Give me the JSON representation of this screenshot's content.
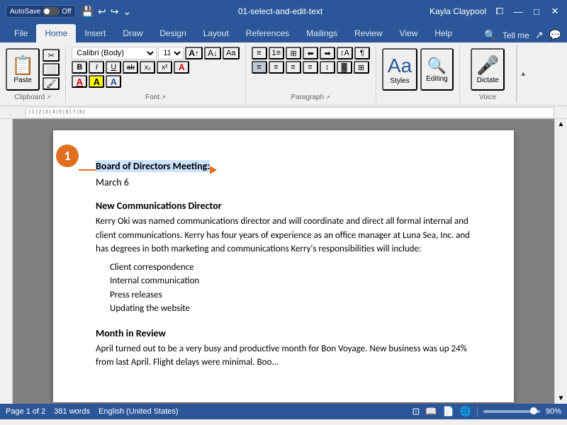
{
  "titleBar": {
    "autosave": "AutoSave",
    "autosaveState": "Off",
    "filename": "01-select-and-edit-text",
    "user": "Kayla Claypool",
    "undoIcon": "↩",
    "redoIcon": "↪",
    "moreIcon": "⌄"
  },
  "ribbonTabs": {
    "tabs": [
      "File",
      "Home",
      "Insert",
      "Draw",
      "Design",
      "Layout",
      "References",
      "Mailings",
      "Review",
      "View",
      "Help"
    ],
    "activeTab": "Home",
    "tellMe": "Tell me"
  },
  "clipboard": {
    "groupLabel": "Clipboard",
    "paste": "Paste",
    "cut": "✂",
    "copy": "⬜",
    "formatPainter": "🖌"
  },
  "font": {
    "groupLabel": "Font",
    "fontName": "Calibri (Body)",
    "fontSize": "11",
    "bold": "B",
    "italic": "I",
    "underline": "U",
    "strikethrough": "ab",
    "subscript": "x₂",
    "superscript": "x²",
    "clearFormat": "A",
    "fontColor": "A",
    "highlight": "A",
    "textEffect": "A",
    "increaseSize": "A↑",
    "decreaseSize": "A↓",
    "changeCase": "Aa"
  },
  "paragraph": {
    "groupLabel": "Paragraph",
    "bullets": "≡",
    "numbering": "1≡",
    "multilevel": "⊞≡",
    "decreaseIndent": "⬅≡",
    "increaseIndent": "➡≡",
    "sort": "↕A",
    "showHide": "¶",
    "alignLeft": "≡",
    "alignCenter": "≡",
    "alignRight": "≡",
    "justify": "≡",
    "lineSpacing": "↕",
    "shading": "▓",
    "borders": "⊞",
    "alignBottom": "⬇"
  },
  "styles": {
    "groupLabel": "Styles",
    "editing": "Editing",
    "editingLabel": "Editing"
  },
  "voice": {
    "groupLabel": "Voice",
    "dictate": "Dictate",
    "dictateIcon": "🎤"
  },
  "document": {
    "calloutNumber": "1",
    "headingText": "Board of Directors Meeting:",
    "date": "March 6",
    "section1": "New Communications Director",
    "para1": "Kerry Oki was named communications director and will coordinate and direct all formal internal and client communications. Kerry has four years of experience as an office manager at Luna Sea, Inc. and has degrees in both marketing and communications Kerry's responsibilities will include:",
    "listItems": [
      "Client correspondence",
      "Internal communication",
      "Press releases",
      "Updating the website"
    ],
    "section2": "Month in Review",
    "para2": "April turned out to be a very busy and productive month for Bon Voyage. New business was up 24% from last April. Flight delays were minimal. Boo..."
  },
  "statusBar": {
    "pageInfo": "Page 1 of 2",
    "wordCount": "381 words",
    "language": "English (United States)",
    "focusMode": "Focus",
    "zoomLevel": "90%"
  }
}
